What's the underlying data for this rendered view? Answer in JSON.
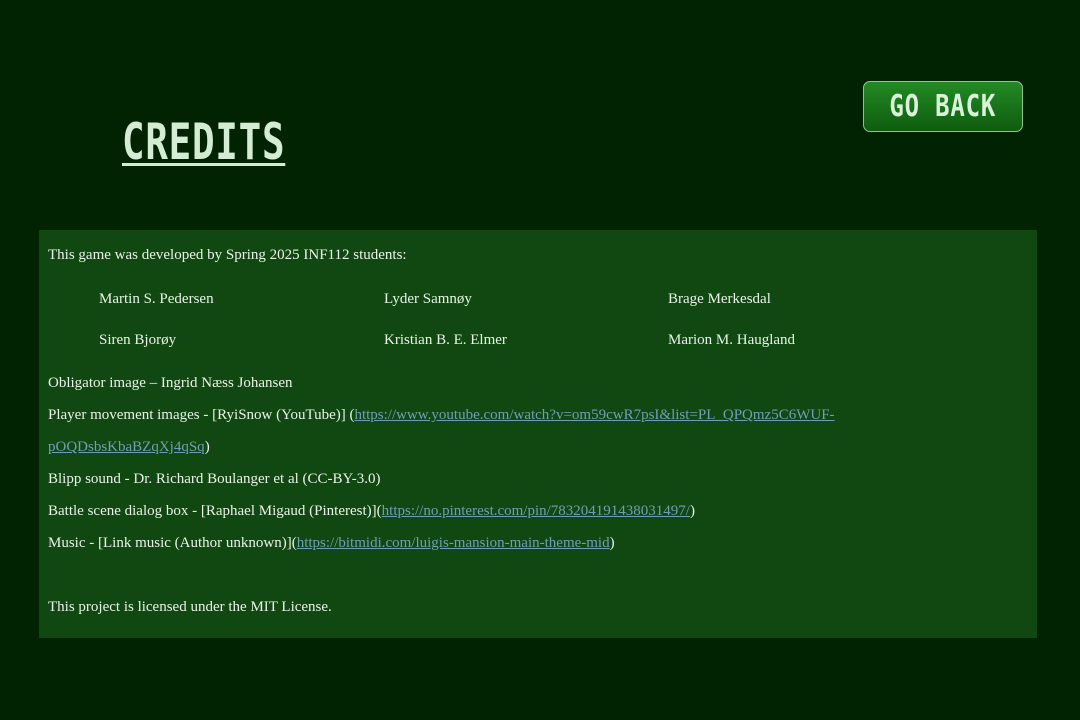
{
  "header": {
    "title": "CREDITS",
    "back_label": "GO BACK"
  },
  "credits": {
    "intro": "This game was developed by Spring 2025 INF112 students:",
    "developers": [
      "Martin S. Pedersen",
      "Lyder Samnøy",
      "Brage Merkesdal",
      "Siren Bjorøy",
      "Kristian B. E. Elmer",
      "Marion M. Haugland"
    ],
    "obligator": "Obligator image – Ingrid Næss Johansen",
    "player_movement": {
      "text": "Player movement images - [RyiSnow (YouTube)] (",
      "url_part1": "https://www.youtube.com/watch?v=om59cwR7psI&list=PL_QPQmz5C6WUF-",
      "url_part2": "pOQDsbsKbaBZqXj4qSq",
      "suffix": ")"
    },
    "blipp": "Blipp sound - Dr. Richard Boulanger et al (CC-BY-3.0)",
    "battle": {
      "text": "Battle scene dialog box - [Raphael Migaud (Pinterest)](",
      "url": "https://no.pinterest.com/pin/783204191438031497/",
      "suffix": ")"
    },
    "music": {
      "text": "Music - [Link music (Author unknown)](",
      "url": "https://bitmidi.com/luigis-mansion-main-theme-mid",
      "suffix": ")"
    },
    "license": "This project is licensed under the MIT License."
  },
  "colors": {
    "background": "#012301",
    "panel": "#114711",
    "link": "#6f9fb6",
    "button": "#1a7a1a"
  }
}
